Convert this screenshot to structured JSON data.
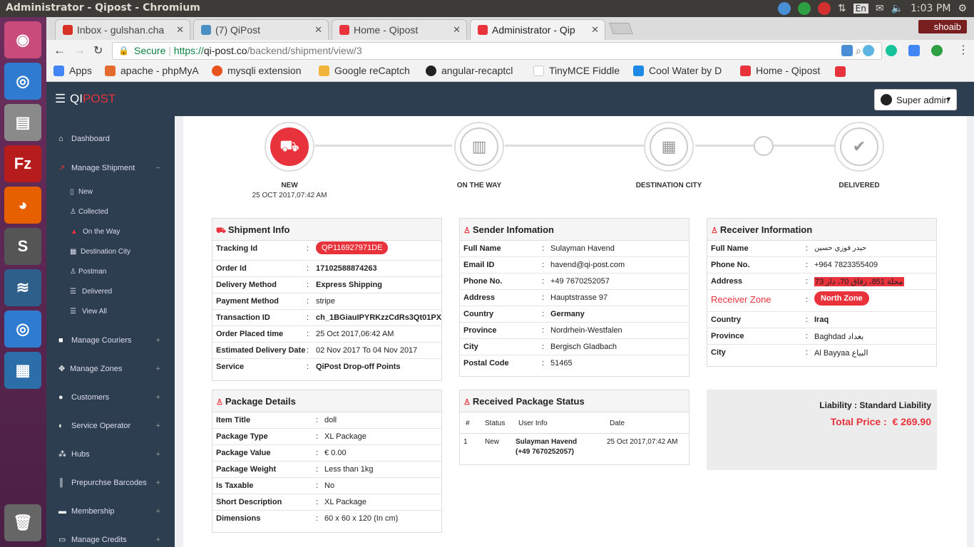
{
  "os": {
    "title": "Administrator - Qipost - Chromium",
    "lang": "En",
    "time": "1:03 PM"
  },
  "browser": {
    "tabs": [
      {
        "label": "Inbox - gulshan.cha",
        "color": "#d93025"
      },
      {
        "label": "(7) QiPost",
        "color": "#4a90c2"
      },
      {
        "label": "Home - Qipost",
        "color": "#e8323c"
      },
      {
        "label": "Administrator - Qip",
        "color": "#e8323c"
      }
    ],
    "user": "shoaib",
    "url": {
      "secure": "Secure",
      "scheme": "https://",
      "host": "qi-post.co",
      "path": "/backend/shipment/view/3"
    },
    "bookmarks": [
      {
        "label": "Apps"
      },
      {
        "label": "apache - phpMyA"
      },
      {
        "label": "mysqli extension"
      },
      {
        "label": "Google reCaptch"
      },
      {
        "label": "angular-recaptcl"
      },
      {
        "label": "TinyMCE Fiddle"
      },
      {
        "label": "Cool Water by D"
      },
      {
        "label": "Home - Qipost"
      }
    ]
  },
  "app": {
    "brand_a": "QI",
    "brand_b": "POST",
    "account": "Super admin"
  },
  "sidebar": {
    "dashboard": "Dashboard",
    "manage_shipment": "Manage Shipment",
    "sub": [
      "New",
      "Collected",
      "On the Way",
      "Destination City",
      "Postman",
      "Delivered",
      "View All"
    ],
    "items": [
      "Manage Couriers",
      "Manage Zones",
      "Customers",
      "Service Operator",
      "Hubs",
      "Prepurchse Barcodes",
      "Membership",
      "Manage Credits"
    ]
  },
  "progress": {
    "steps": [
      "NEW",
      "ON THE WAY",
      "DESTINATION CITY",
      "DELIVERED"
    ],
    "new_date": "25 OCT 2017,07:42 AM"
  },
  "shipment": {
    "title": "Shipment Info",
    "rows": [
      {
        "k": "Tracking Id",
        "v": "QP116927971DE"
      },
      {
        "k": "Order Id",
        "v": "17102588874263"
      },
      {
        "k": "Delivery Method",
        "v": "Express Shipping"
      },
      {
        "k": "Payment Method",
        "v": "stripe"
      },
      {
        "k": "Transaction ID",
        "v": "ch_1BGiauIPYRKzzCdRs3Qt01PX"
      },
      {
        "k": "Order Placed time",
        "v": "25 Oct 2017,06:42 AM"
      },
      {
        "k": "Estimated Delivery Date",
        "v": "02 Nov 2017 To 04 Nov 2017"
      },
      {
        "k": "Service",
        "v": "QiPost Drop-off Points"
      }
    ]
  },
  "sender": {
    "title": "Sender Infomation",
    "rows": [
      {
        "k": "Full Name",
        "v": "Sulayman Havend"
      },
      {
        "k": "Email ID",
        "v": "havend@qi-post.com"
      },
      {
        "k": "Phone No.",
        "v": "+49 7670252057"
      },
      {
        "k": "Address",
        "v": "Hauptstrasse 97"
      },
      {
        "k": "Country",
        "v": "Germany"
      },
      {
        "k": "Province",
        "v": "Nordrhein-Westfalen"
      },
      {
        "k": "City",
        "v": "Bergisch Gladbach"
      },
      {
        "k": "Postal Code",
        "v": "51465"
      }
    ]
  },
  "receiver": {
    "title": "Receiver Information",
    "rows": [
      {
        "k": "Full Name",
        "v": "حيدر فوزي حسين"
      },
      {
        "k": "Phone No.",
        "v": "+964 7823355409"
      },
      {
        "k": "Address",
        "v": "محلة 851، زقاق 70، دار 73"
      },
      {
        "k": "Receiver Zone",
        "v": "North Zone"
      },
      {
        "k": "Country",
        "v": "Iraq"
      },
      {
        "k": "Province",
        "v": "Baghdad بغداد"
      },
      {
        "k": "City",
        "v": "Al Bayyaa البياع"
      }
    ]
  },
  "package": {
    "title": "Package Details",
    "rows": [
      {
        "k": "Item Title",
        "v": "doll"
      },
      {
        "k": "Package Type",
        "v": "XL Package"
      },
      {
        "k": "Package Value",
        "v": "€ 0.00"
      },
      {
        "k": "Package Weight",
        "v": "Less than 1kg"
      },
      {
        "k": "Is Taxable",
        "v": "No"
      },
      {
        "k": "Short Description",
        "v": "XL Package"
      },
      {
        "k": "Dimensions",
        "v": "60 x 60 x 120 (In cm)"
      }
    ]
  },
  "status": {
    "title": "Received Package Status",
    "headers": [
      "#",
      "Status",
      "User Info",
      "Date"
    ],
    "row": {
      "num": "1",
      "status": "New",
      "user_name": "Sulayman Havend",
      "user_phone": "(+49 7670252057)",
      "date": "25 Oct 2017,07:42 AM"
    }
  },
  "price": {
    "liability_label": "Liability :",
    "liability_value": "Standard Liability",
    "total_label": "Total Price :",
    "total_value": "€ 269.90"
  },
  "colors": {
    "accent": "#e8323c",
    "header": "#2c3e50"
  }
}
